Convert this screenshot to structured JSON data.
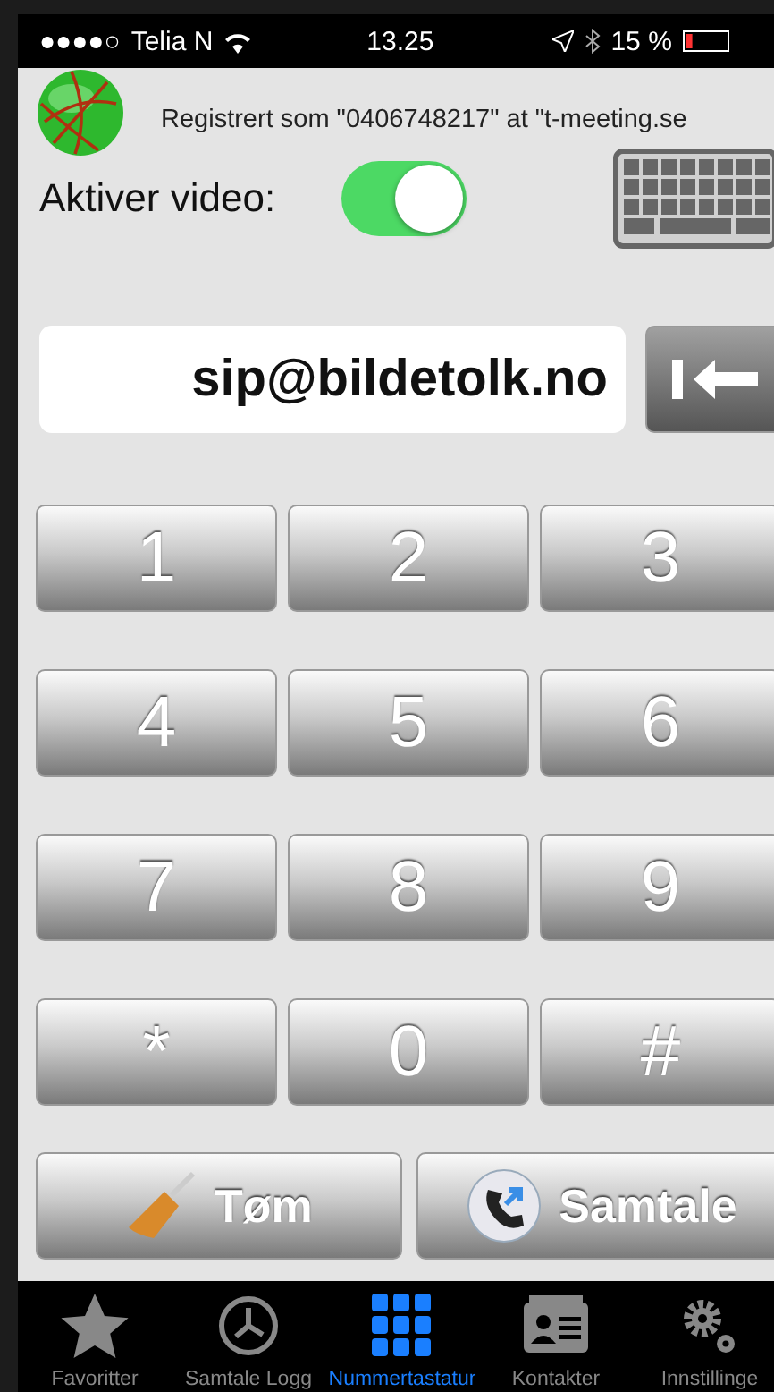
{
  "status_bar": {
    "signal": "●●●●○",
    "carrier": "Telia N",
    "time": "13.25",
    "battery": {
      "label": "15 %",
      "level": 0.15
    }
  },
  "registration": "Registrert som \"0406748217\" at \"t-meeting.se",
  "video": {
    "label": "Aktiver video:",
    "on": true
  },
  "address_field": {
    "value": "sip@bildetolk.no"
  },
  "keys": [
    "1",
    "2",
    "3",
    "4",
    "5",
    "6",
    "7",
    "8",
    "9",
    "*",
    "0",
    "#"
  ],
  "actions": [
    {
      "kind": "clear",
      "label": "Tøm"
    },
    {
      "kind": "call",
      "label": "Samtale"
    }
  ],
  "tabs": [
    {
      "kind": "star",
      "label": "Favoritter",
      "selected": false
    },
    {
      "kind": "clock",
      "label": "Samtale Logg",
      "selected": false
    },
    {
      "kind": "keypad",
      "label": "Nummertastatur",
      "selected": true
    },
    {
      "kind": "contact",
      "label": "Kontakter",
      "selected": false
    },
    {
      "kind": "gears",
      "label": "Innstillinge",
      "selected": false
    }
  ]
}
